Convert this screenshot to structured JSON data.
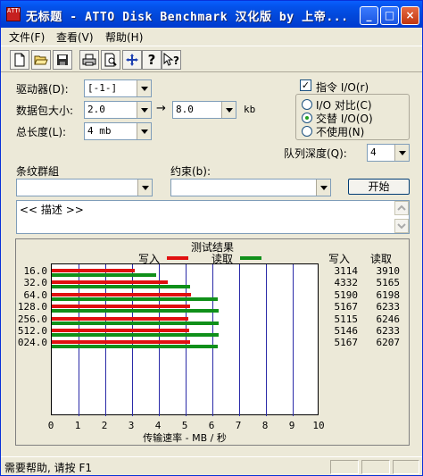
{
  "window": {
    "title": "无标题 - ATTO Disk Benchmark  汉化版 by 上帝...",
    "icon_label": "ATTO"
  },
  "menu": [
    "文件(F)",
    "查看(V)",
    "帮助(H)"
  ],
  "toolbar_icons": [
    "new-icon",
    "open-icon",
    "save-icon",
    "print-icon",
    "print-preview-icon",
    "move-icon",
    "help-icon",
    "context-help-icon"
  ],
  "form": {
    "drive_label": "驱动器(D):",
    "drive_value": "[-1-]",
    "transfer_label": "数据包大小:",
    "transfer_from": "2.0",
    "transfer_to": "8.0",
    "transfer_unit": "kb",
    "arrow": "→",
    "total_label": "总长度(L):",
    "total_value": "4 mb",
    "direct_io_label": "指令 I/O(r)",
    "direct_io_checked": true,
    "io_compare_label": "I/O 对比(C)",
    "overlapped_label": "交替 I/O(O)",
    "neither_label": "不使用(N)",
    "queue_label": "队列深度(Q):",
    "queue_value": "4",
    "stripe_label": "条纹群組",
    "stripe_value": "",
    "constraint_label": "约束(b):",
    "constraint_value": "",
    "start_button": "开始",
    "description": "<< 描述 >>"
  },
  "results": {
    "title": "测试结果",
    "write_legend": "写入",
    "read_legend": "读取",
    "write_header": "写入",
    "read_header": "读取",
    "rows": [
      {
        "size": "16.0",
        "write": "3114",
        "read": "3910"
      },
      {
        "size": "32.0",
        "write": "4332",
        "read": "5165"
      },
      {
        "size": "64.0",
        "write": "5190",
        "read": "6198"
      },
      {
        "size": "128.0",
        "write": "5167",
        "read": "6233"
      },
      {
        "size": "256.0",
        "write": "5115",
        "read": "6246"
      },
      {
        "size": "512.0",
        "write": "5146",
        "read": "6233"
      },
      {
        "size": "024.0",
        "write": "5167",
        "read": "6207"
      }
    ]
  },
  "chart_data": {
    "type": "bar",
    "title": "测试结果",
    "xlabel": "传输速率 - MB / 秒",
    "xlim": [
      0,
      10
    ],
    "xticks": [
      "0",
      "1",
      "2",
      "3",
      "4",
      "5",
      "6",
      "7",
      "8",
      "9",
      "10"
    ],
    "categories": [
      "16.0",
      "32.0",
      "64.0",
      "128.0",
      "256.0",
      "512.0",
      "024.0"
    ],
    "series": [
      {
        "name": "写入",
        "color": "#e01010",
        "values": [
          3.114,
          4.332,
          5.19,
          5.167,
          5.115,
          5.146,
          5.167
        ]
      },
      {
        "name": "读取",
        "color": "#10901a",
        "values": [
          3.91,
          5.165,
          6.198,
          6.233,
          6.246,
          6.233,
          6.207
        ]
      }
    ]
  },
  "status": {
    "text": "需要帮助, 请按 F1"
  }
}
